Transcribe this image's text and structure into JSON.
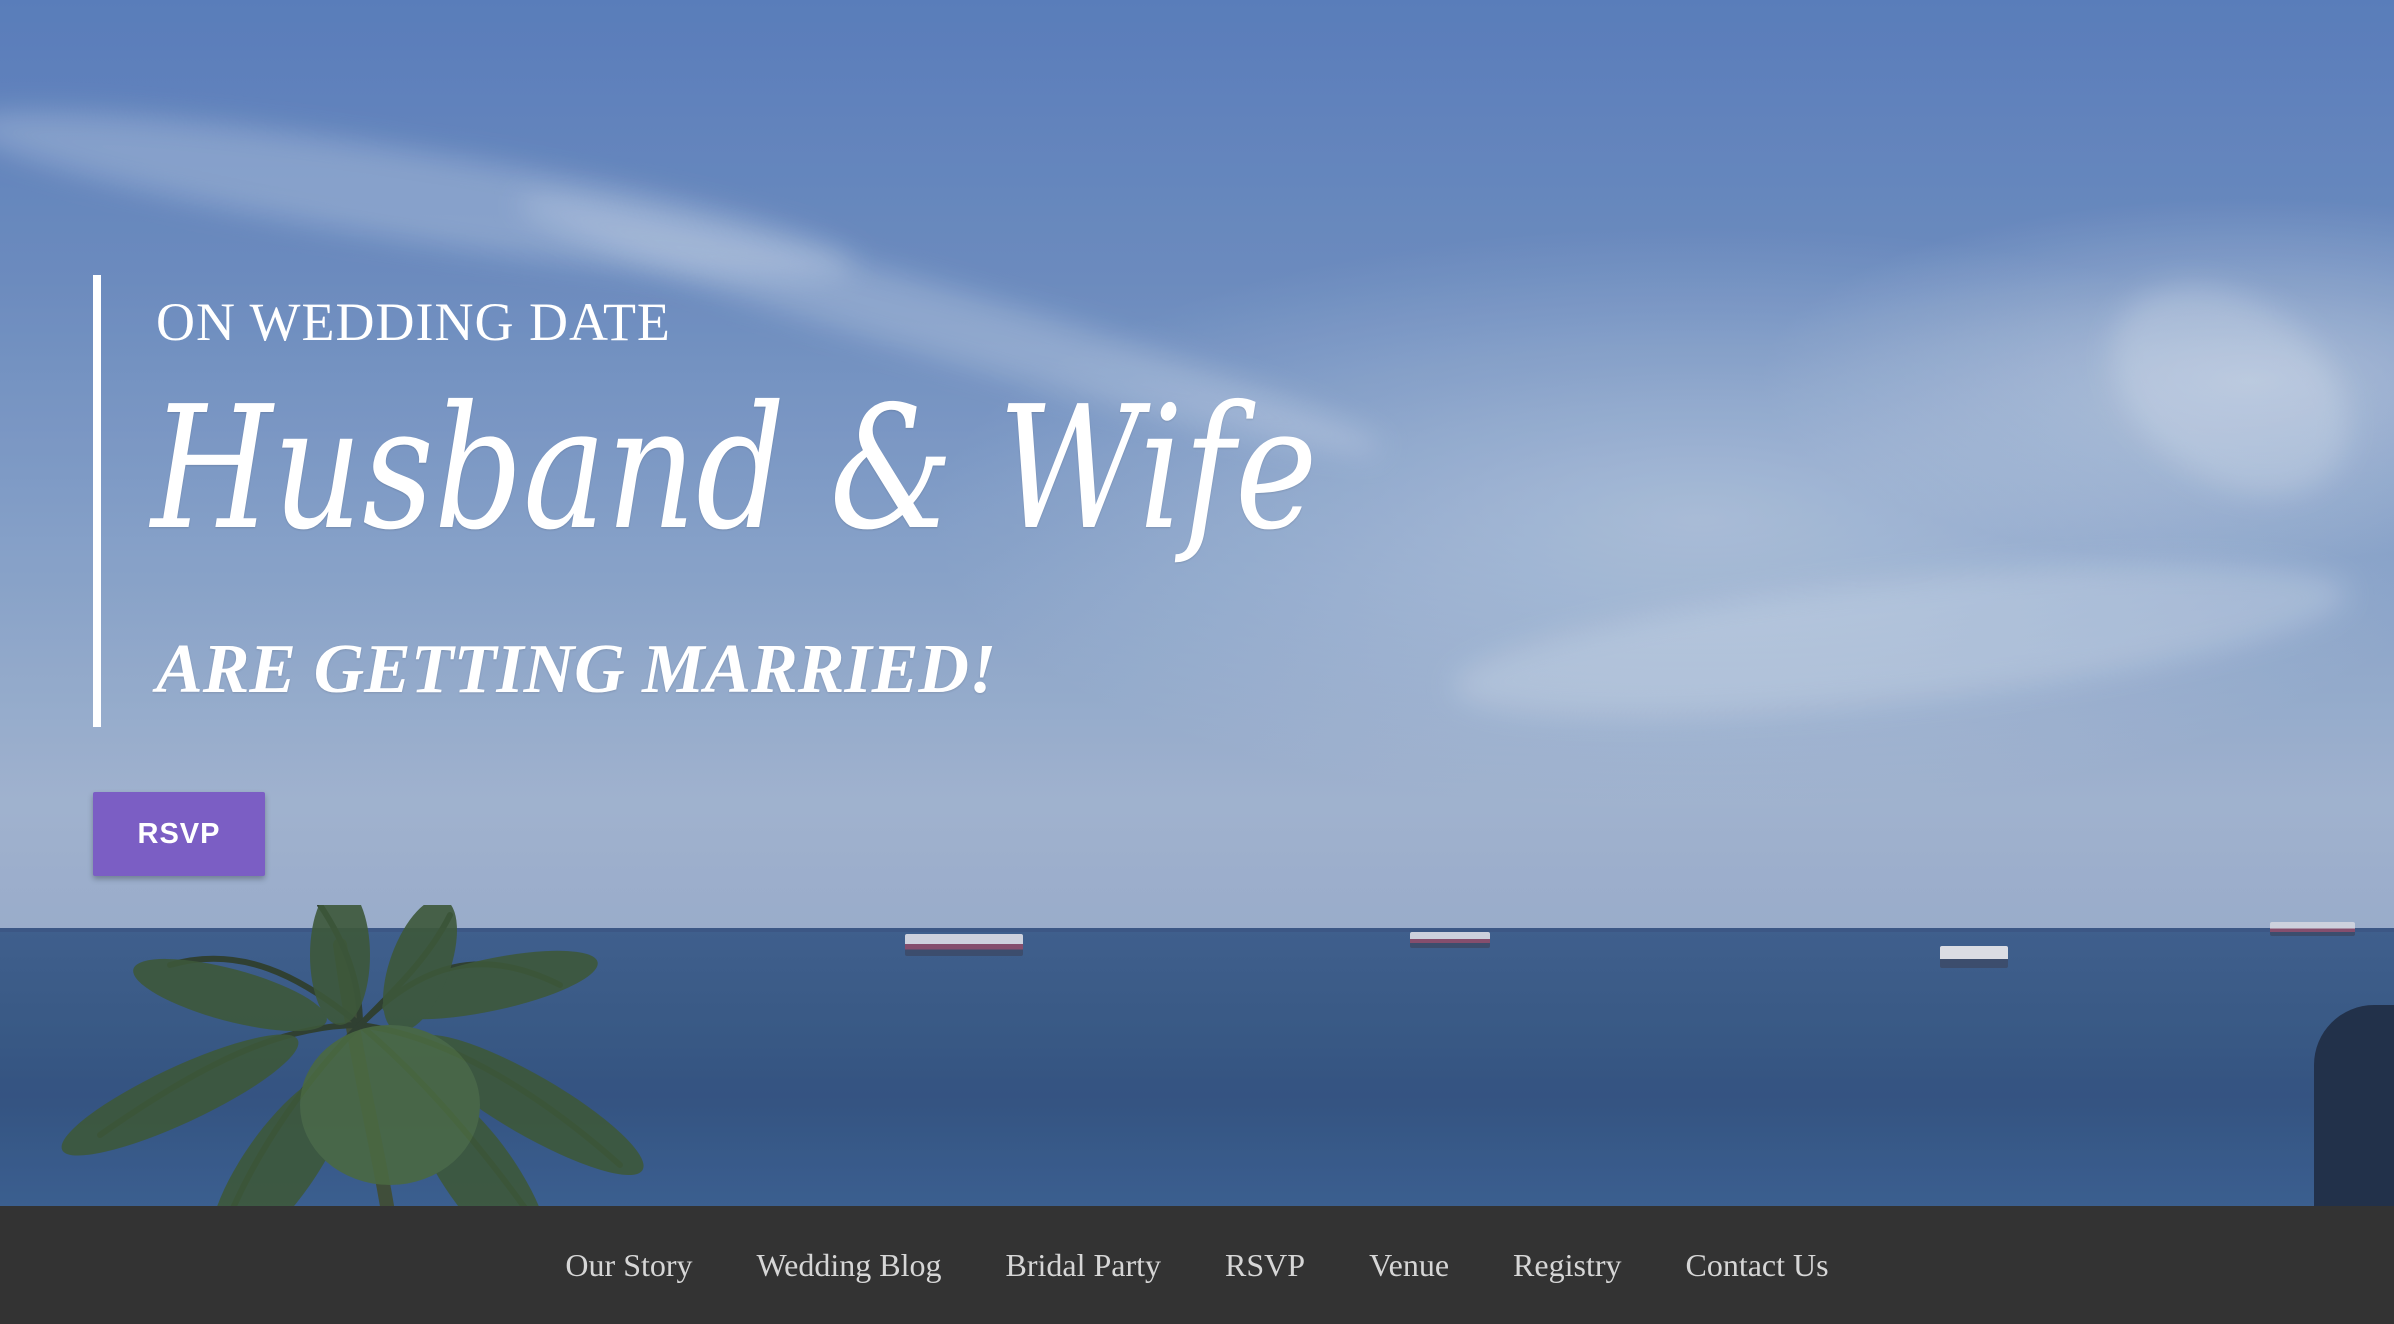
{
  "hero": {
    "pre_title": "ON WEDDING DATE",
    "names": "Husband & Wife",
    "sub_title": "ARE GETTING MARRIED!",
    "rsvp_button": "RSVP"
  },
  "nav": {
    "items": [
      "Our Story",
      "Wedding Blog",
      "Bridal Party",
      "RSVP",
      "Venue",
      "Registry",
      "Contact Us"
    ]
  },
  "colors": {
    "accent": "#7b5ec4",
    "nav_background": "#333333",
    "nav_text": "#d6d6d6",
    "hero_text": "#ffffff"
  }
}
